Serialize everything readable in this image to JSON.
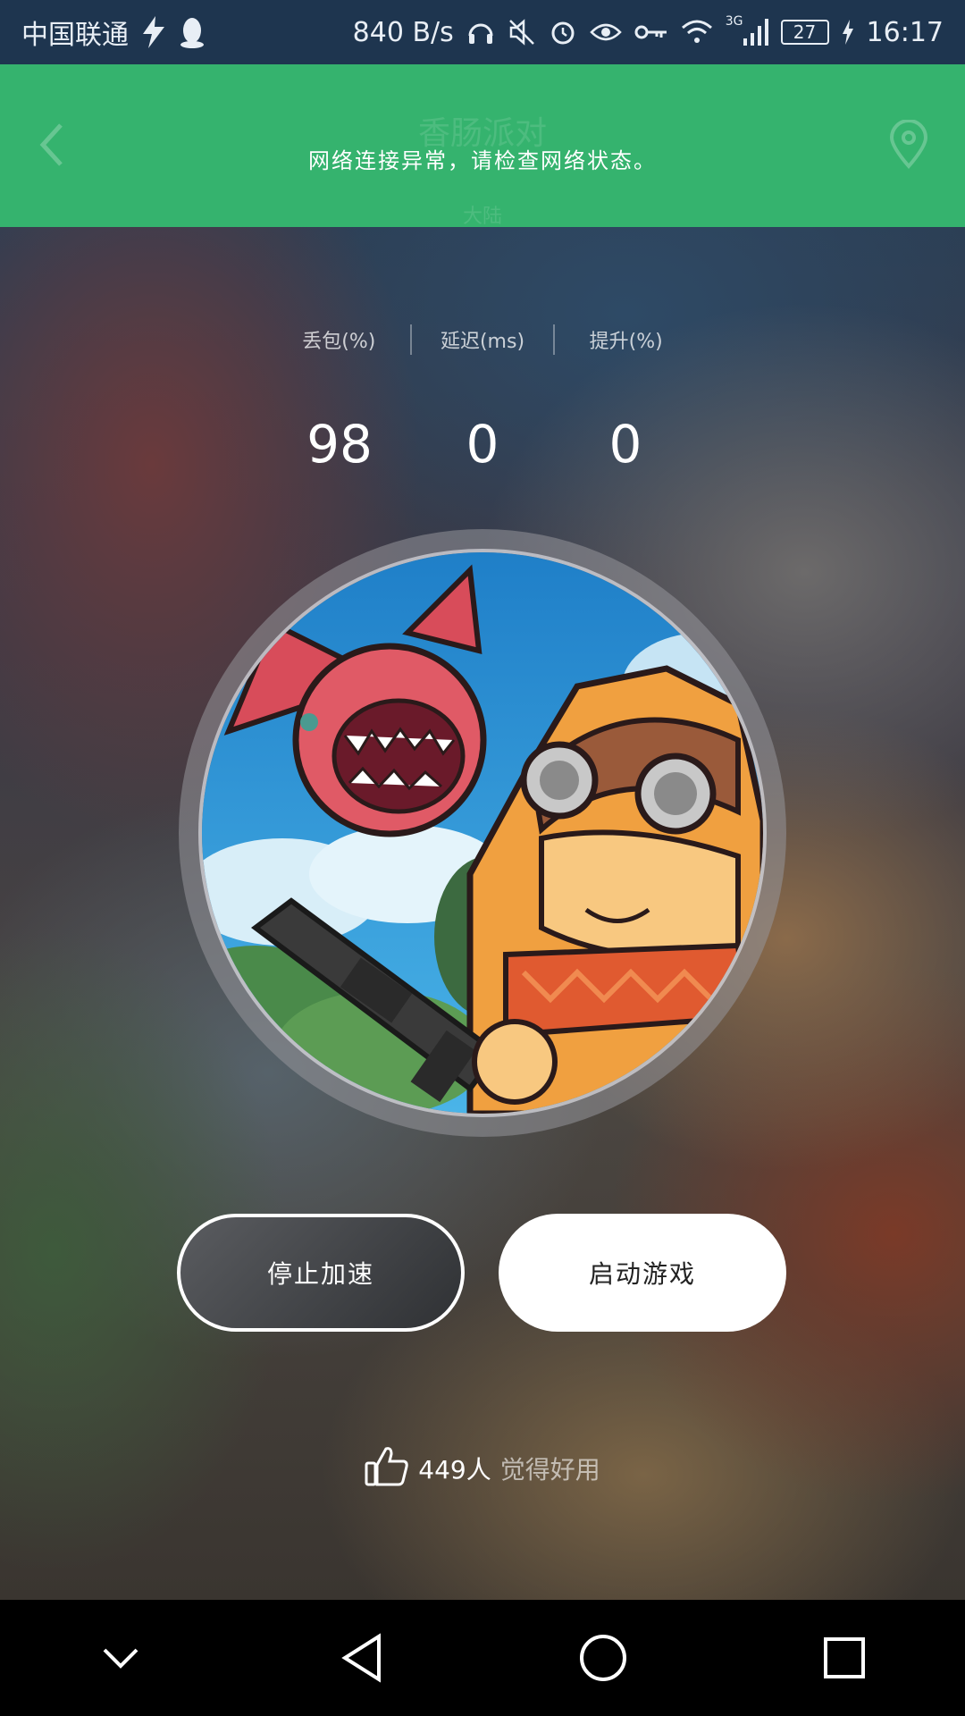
{
  "status_bar": {
    "carrier": "中国联通",
    "net_speed": "840 B/s",
    "network_type": "3G",
    "battery": "27",
    "time": "16:17"
  },
  "header": {
    "title": "香肠派对",
    "subtitle": "大陆",
    "message": "网络连接异常，请检查网络状态。"
  },
  "stats": [
    {
      "label": "丢包(%)",
      "value": "98"
    },
    {
      "label": "延迟(ms)",
      "value": "0"
    },
    {
      "label": "提升(%)",
      "value": "0"
    }
  ],
  "buttons": {
    "stop": "停止加速",
    "start": "启动游戏"
  },
  "likes": {
    "count": "449人",
    "suffix": "觉得好用"
  },
  "colors": {
    "header_green": "#35b36e",
    "button_white": "#ffffff"
  }
}
